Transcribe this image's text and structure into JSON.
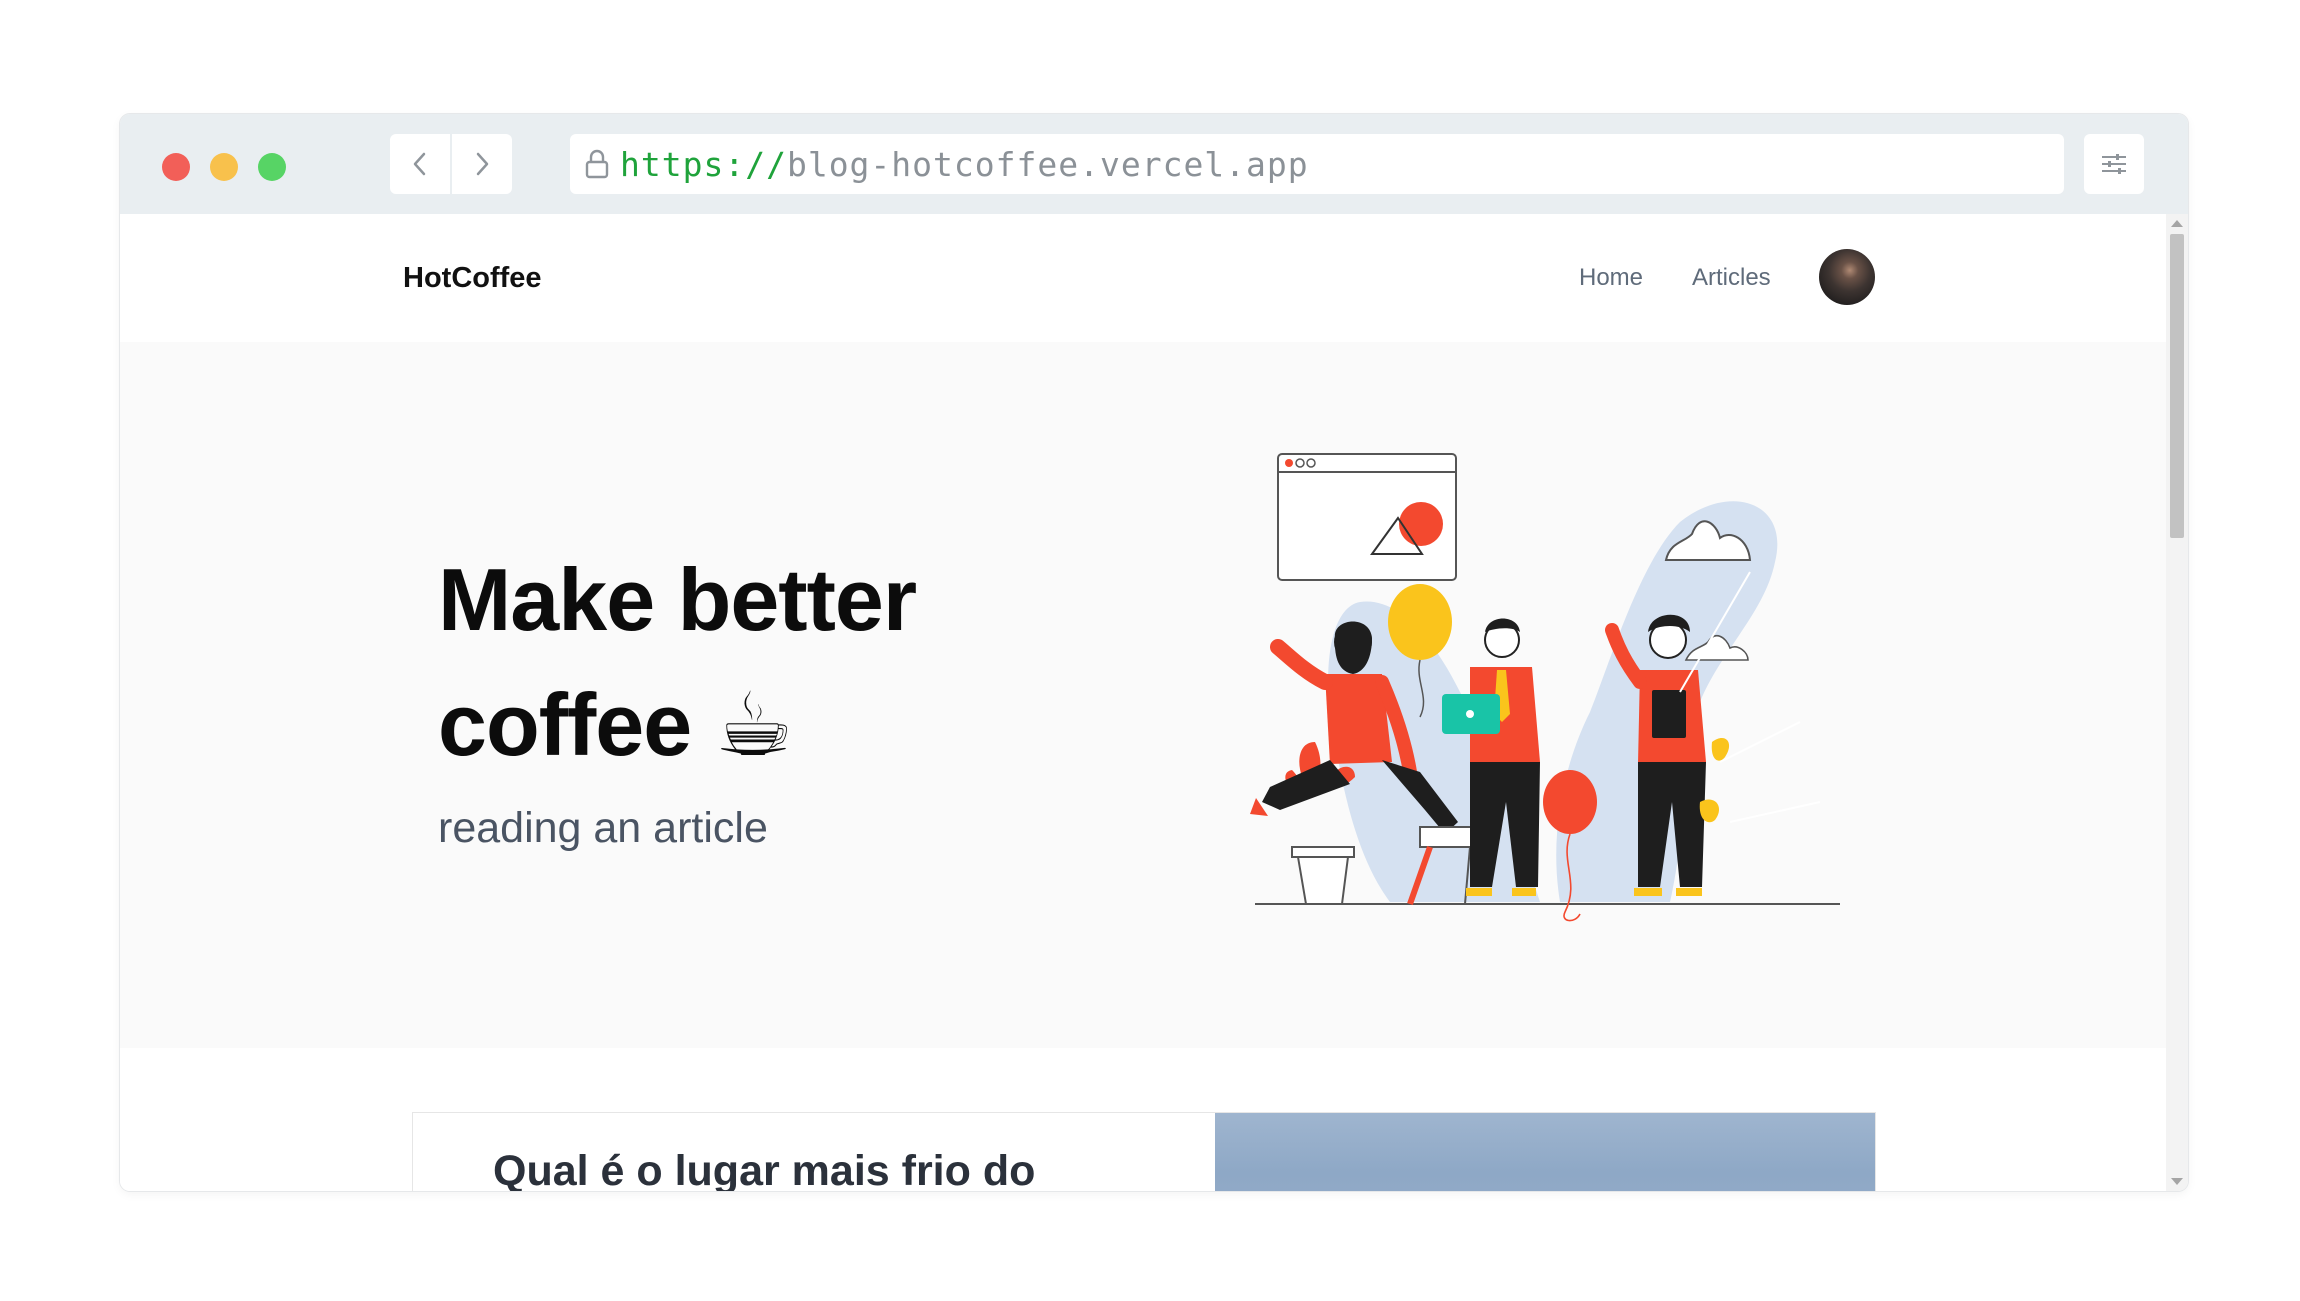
{
  "browser": {
    "url_protocol": "https://",
    "url_host": "blog-hotcoffee.vercel.app"
  },
  "header": {
    "brand": "HotCoffee",
    "nav": [
      "Home",
      "Articles"
    ]
  },
  "hero": {
    "title_line1": "Make better",
    "title_line2": "coffee ☕",
    "subtitle": "reading an article"
  },
  "article_card": {
    "title": "Qual é o lugar mais frio do"
  },
  "colors": {
    "accent_red": "#f3492f",
    "accent_yellow": "#fac41c",
    "accent_teal": "#19c4a7",
    "blob_blue": "#d5e1f1",
    "url_green": "#1fa33b"
  }
}
